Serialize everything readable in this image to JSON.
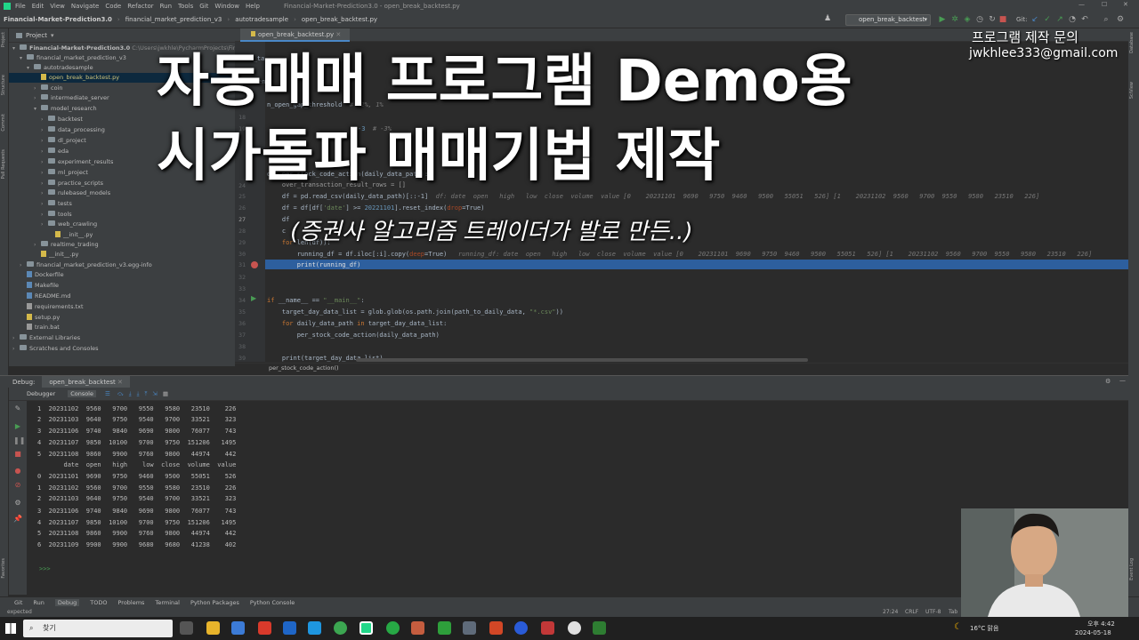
{
  "menu": [
    "File",
    "Edit",
    "View",
    "Navigate",
    "Code",
    "Refactor",
    "Run",
    "Tools",
    "Git",
    "Window",
    "Help"
  ],
  "window_title": "Financial-Market-Prediction3.0 - open_break_backtest.py",
  "breadcrumbs": [
    "Financial-Market-Prediction3.0",
    "financial_market_prediction_v3",
    "autotradesample",
    "open_break_backtest.py"
  ],
  "run_config": "open_break_backtest",
  "git_label": "Git:",
  "project": {
    "header": "Project",
    "root": "Financial-Market-Prediction3.0",
    "root_path": "C:\\Users\\jwkhle\\PycharmProjects\\Finan",
    "items": [
      {
        "label": "financial_market_prediction_v3",
        "type": "folder",
        "open": true
      },
      {
        "label": "autotradesample",
        "type": "folder",
        "open": true
      },
      {
        "label": "open_break_backtest.py",
        "type": "file"
      },
      {
        "label": "coin",
        "type": "folder"
      },
      {
        "label": "intermediate_server",
        "type": "folder"
      },
      {
        "label": "model_research",
        "type": "folder",
        "open": true
      },
      {
        "label": "backtest",
        "type": "folder"
      },
      {
        "label": "data_processing",
        "type": "folder"
      },
      {
        "label": "dl_project",
        "type": "folder"
      },
      {
        "label": "eda",
        "type": "folder"
      },
      {
        "label": "experiment_results",
        "type": "folder"
      },
      {
        "label": "ml_project",
        "type": "folder"
      },
      {
        "label": "practice_scripts",
        "type": "folder"
      },
      {
        "label": "rulebased_models",
        "type": "folder"
      },
      {
        "label": "tests",
        "type": "folder"
      },
      {
        "label": "tools",
        "type": "folder"
      },
      {
        "label": "web_crawling",
        "type": "folder"
      },
      {
        "label": "__init__.py",
        "type": "file"
      },
      {
        "label": "realtime_trading",
        "type": "folder"
      },
      {
        "label": "__init__.py",
        "type": "file"
      },
      {
        "label": "financial_market_prediction_v3.egg-info",
        "type": "folder"
      },
      {
        "label": "Dockerfile",
        "type": "file"
      },
      {
        "label": "Makefile",
        "type": "file"
      },
      {
        "label": "README.md",
        "type": "file"
      },
      {
        "label": "requirements.txt",
        "type": "file"
      },
      {
        "label": "setup.py",
        "type": "file"
      },
      {
        "label": "train.bat",
        "type": "file"
      },
      {
        "label": "External Libraries",
        "type": "folder"
      },
      {
        "label": "Scratches and Consoles",
        "type": "folder"
      }
    ]
  },
  "editor": {
    "tab": "open_break_backtest.py",
    "line_numbers": [
      "18",
      "19",
      "",
      "24",
      "25",
      "26",
      "27",
      "28",
      "29",
      "30",
      "31",
      "32",
      "33",
      "34",
      "35",
      "36",
      "37",
      "38",
      "39"
    ],
    "lines": {
      "l1": "min_ta",
      "l2": "ent",
      "l3": "n_open_gap_",
      "l4": "threshold",
      "l5": "# -2%, 1%",
      "l6": "-3",
      "l7": "# -3%",
      "def_line": "def per_stock_code_action(daily_data_path):",
      "over_line": "    over_transaction_result_rows = []",
      "l24": "    df = pd.read_csv(daily_data_path)[::-1]",
      "l24_hint": "  df: date  open   high   low  close  volume  value [0    20231101  9690   9750  9460   9500   55051   526] [1    20231102  9560   9700  9550   9580   23510   226]",
      "l25a": "    df = df[df[",
      "l25b": "'date'",
      "l25c": "] >= ",
      "l25d": "20221101",
      "l25e": "].reset_index(",
      "l25f": "drop",
      "l25g": "=True)",
      "l26": "    df",
      "l27": "    c",
      "l28a": "    for",
      "l28b": " len(df)):",
      "l29": "        running_df = df.iloc[:i].copy(",
      "l29b": "deep",
      "l29c": "=True)",
      "l29_hint": "   running_df: date  open   high   low  close  volume  value [0    20231101  9690   9750  9460   9500   55051   526] [1    20231102  9560   9700  9550   9580   23510   226]",
      "l30": "        print(running_df)",
      "main_a": "if",
      "main_b": " __name__ == ",
      "main_c": "\"__main__\"",
      "main_d": ":",
      "glob_a": "    target_day_data_list = glob.glob(os.path.join(path_to_daily_data, ",
      "glob_b": "\"*.csv\"",
      "glob_c": "))",
      "for_a": "    for",
      "for_b": " daily_data_path ",
      "for_c": "in",
      "for_d": " target_day_data_list:",
      "call": "        per_stock_code_action(daily_data_path)",
      "print": "    print(target_day_data_list)"
    },
    "bottom_breadcrumb": "per_stock_code_action()"
  },
  "debug": {
    "label": "Debug:",
    "tab": "open_break_backtest",
    "sub_tabs": [
      "Debugger",
      "Console"
    ],
    "console_rows": [
      "1  20231102  9560   9700   9550   9580   23510    226",
      "2  20231103  9640   9750   9540   9700   33521    323",
      "3  20231106  9740   9840   9690   9800   76077    743",
      "4  20231107  9850  10100   9700   9750  151206   1495",
      "5  20231108  9860   9900   9760   9800   44974    442",
      "       date  open   high    low  close  volume  value",
      "0  20231101  9690   9750   9460   9500   55051    526",
      "1  20231102  9560   9700   9550   9580   23510    226",
      "2  20231103  9640   9750   9540   9700   33521    323",
      "3  20231106  9740   9840   9690   9800   76077    743",
      "4  20231107  9850  10100   9700   9750  151206   1495",
      "5  20231108  9860   9900   9760   9800   44974    442",
      "6  20231109  9900   9900   9680   9680   41238    402"
    ],
    "prompt": ">>>"
  },
  "bottom_tabs": [
    "Git",
    "Run",
    "Debug",
    "TODO",
    "Problems",
    "Terminal",
    "Python Packages",
    "Python Console"
  ],
  "status": {
    "left": "expected",
    "position": "27:24",
    "eol": "CRLF",
    "encoding": "UTF-8",
    "tab": "Tab",
    "branch": "master"
  },
  "taskbar": {
    "search": "찾기",
    "weather": "16°C  맑음",
    "time": "오후 4:42",
    "date": "2024-05-18"
  },
  "overlay": {
    "title_line1": "자동매매 프로그램 Demo용",
    "title_line2": "시가돌파 매매기법 제작",
    "subtitle": "(증권사 알고리즘 트레이더가 발로 만든..)",
    "contact_label": "프로그램 제작 문의",
    "contact_email": "jwkhlee333@gmail.com"
  }
}
